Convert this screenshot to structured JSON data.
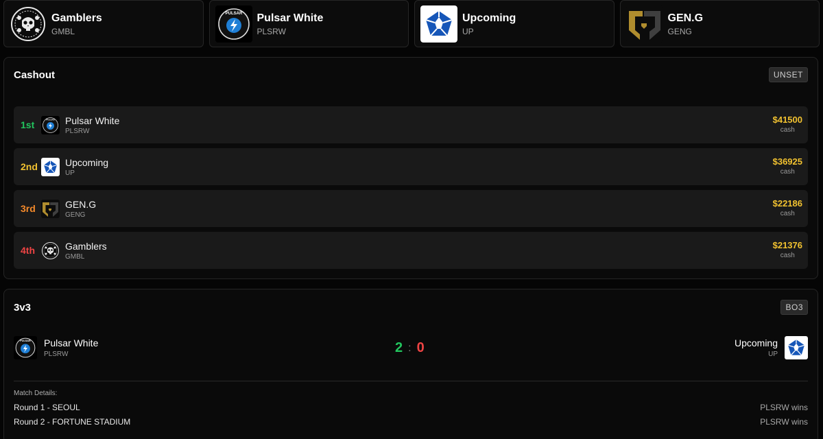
{
  "teams": [
    {
      "name": "Gamblers",
      "abbr": "GMBL",
      "logo_icon": "gamblers-skull-logo"
    },
    {
      "name": "Pulsar White",
      "abbr": "PLSRW",
      "logo_icon": "pulsar-lightning-logo"
    },
    {
      "name": "Upcoming",
      "abbr": "UP",
      "logo_icon": "upcoming-pentagon-logo"
    },
    {
      "name": "GEN.G",
      "abbr": "GENG",
      "logo_icon": "geng-gold-logo"
    }
  ],
  "cashout": {
    "title": "Cashout",
    "status_pill": "UNSET",
    "ranks": [
      {
        "pos": "1st",
        "pos_color": "#22c55e",
        "name": "Pulsar White",
        "abbr": "PLSRW",
        "amount": "$41500",
        "amount_label": "cash"
      },
      {
        "pos": "2nd",
        "pos_color": "#f2c230",
        "name": "Upcoming",
        "abbr": "UP",
        "amount": "$36925",
        "amount_label": "cash"
      },
      {
        "pos": "3rd",
        "pos_color": "#f58a2a",
        "name": "GEN.G",
        "abbr": "GENG",
        "amount": "$22186",
        "amount_label": "cash"
      },
      {
        "pos": "4th",
        "pos_color": "#ef4444",
        "name": "Gamblers",
        "abbr": "GMBL",
        "amount": "$21376",
        "amount_label": "cash"
      }
    ]
  },
  "match": {
    "title": "3v3",
    "format": "BO3",
    "home": {
      "name": "Pulsar White",
      "abbr": "PLSRW"
    },
    "away": {
      "name": "Upcoming",
      "abbr": "UP"
    },
    "score_home": "2",
    "score_sep": ":",
    "score_away": "0",
    "details_label": "Match Details:",
    "rounds": [
      {
        "name": "Round 1 - SEOUL",
        "result": "PLSRW wins"
      },
      {
        "name": "Round 2 - FORTUNE STADIUM",
        "result": "PLSRW wins"
      }
    ]
  },
  "colors": {
    "accent_gold": "#f2c230",
    "win_green": "#22c55e",
    "loss_red": "#ef4444"
  }
}
